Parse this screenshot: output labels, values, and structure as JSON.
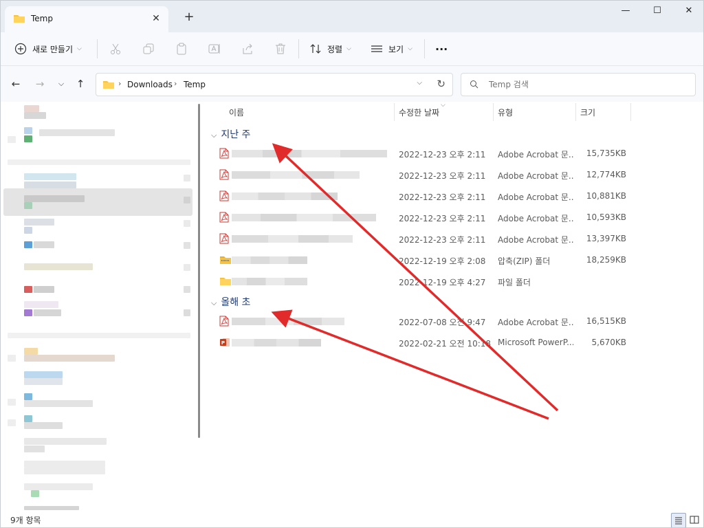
{
  "window": {
    "tab_title": "Temp",
    "tab_close": "✕",
    "new_tab": "+",
    "minimize": "—",
    "maximize": "☐",
    "close": "✕"
  },
  "toolbar": {
    "new_label": "새로 만들기",
    "sort_label": "정렬",
    "view_label": "보기",
    "more_label": "···"
  },
  "address": {
    "crumbs": [
      "Downloads",
      "Temp"
    ],
    "search_placeholder": "Temp 검색"
  },
  "columns": {
    "name": "이름",
    "modified": "수정한 날짜",
    "type": "유형",
    "size": "크기"
  },
  "groups": [
    {
      "label": "지난 주",
      "rows": [
        {
          "icon": "pdf-icon",
          "date": "2022-12-23 오후 2:11",
          "type": "Adobe Acrobat 문...",
          "size": "15,735KB"
        },
        {
          "icon": "pdf-icon",
          "date": "2022-12-23 오후 2:11",
          "type": "Adobe Acrobat 문...",
          "size": "12,774KB"
        },
        {
          "icon": "pdf-icon",
          "date": "2022-12-23 오후 2:11",
          "type": "Adobe Acrobat 문...",
          "size": "10,881KB"
        },
        {
          "icon": "pdf-icon",
          "date": "2022-12-23 오후 2:11",
          "type": "Adobe Acrobat 문...",
          "size": "10,593KB"
        },
        {
          "icon": "pdf-icon",
          "date": "2022-12-23 오후 2:11",
          "type": "Adobe Acrobat 문...",
          "size": "13,397KB"
        },
        {
          "icon": "zip-folder-icon",
          "date": "2022-12-19 오후 2:08",
          "type": "압축(ZIP) 폴더",
          "size": "18,259KB"
        },
        {
          "icon": "folder-icon",
          "date": "2022-12-19 오후 4:27",
          "type": "파일 폴더",
          "size": ""
        }
      ]
    },
    {
      "label": "올해 초",
      "rows": [
        {
          "icon": "pdf-icon",
          "date": "2022-07-08 오전 9:47",
          "type": "Adobe Acrobat 문...",
          "size": "16,515KB"
        },
        {
          "icon": "pptx-icon",
          "date": "2022-02-21 오전 10:18",
          "type": "Microsoft PowerP...",
          "size": "5,670KB"
        }
      ]
    }
  ],
  "status": {
    "count": "9개 항목"
  },
  "colors": {
    "accent": "#1f3b73",
    "arrow": "#e12a2a",
    "pdf": "#d1342f",
    "folder": "#f5c242"
  }
}
